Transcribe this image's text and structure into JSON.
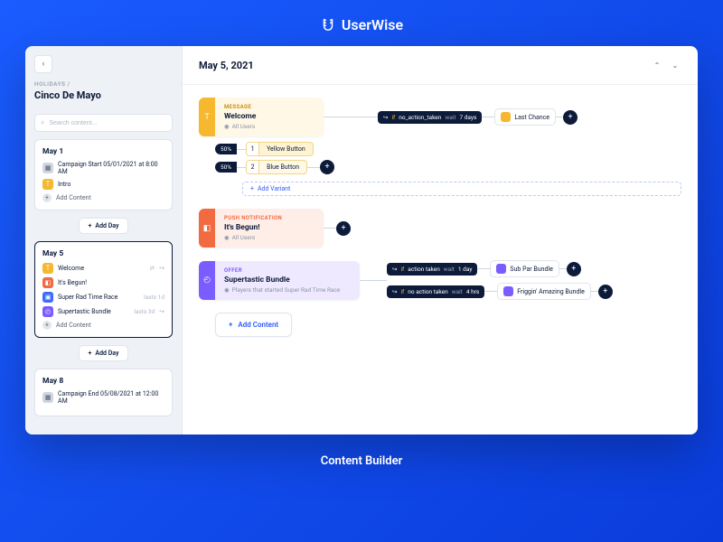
{
  "brand": "UserWise",
  "footer": "Content Builder",
  "sidebar": {
    "breadcrumb": "HOLIDAYS /",
    "title": "Cinco De Mayo",
    "search_placeholder": "Search content...",
    "add_content": "Add Content",
    "add_day": "Add Day",
    "days": [
      {
        "label": "May 1",
        "active": false,
        "items": [
          {
            "badge": "grey",
            "text": "Campaign Start 05/01/2021 at 8:00 AM"
          },
          {
            "badge": "yellow",
            "text": "Intro"
          }
        ]
      },
      {
        "label": "May 5",
        "active": true,
        "items": [
          {
            "badge": "yellow",
            "text": "Welcome",
            "arrow": true
          },
          {
            "badge": "orange",
            "text": "It's Begun!"
          },
          {
            "badge": "blue",
            "text": "Super Rad Time Race",
            "meta": "lasts 1d"
          },
          {
            "badge": "purple",
            "text": "Supertastic Bundle",
            "meta": "lasts 3d",
            "arrow": true
          }
        ]
      },
      {
        "label": "May 8",
        "active": false,
        "items": [
          {
            "badge": "grey",
            "text": "Campaign End 05/08/2021 at 12:00 AM"
          }
        ]
      }
    ]
  },
  "main": {
    "date": "May 5, 2021",
    "add_content": "Add Content",
    "add_variant": "Add Variant"
  },
  "flows": {
    "msg": {
      "type": "MESSAGE",
      "name": "Welcome",
      "audience": "All Users",
      "variants": [
        {
          "pct": "50%",
          "num": "1",
          "label": "Yellow Button"
        },
        {
          "pct": "50%",
          "num": "2",
          "label": "Blue Button"
        }
      ],
      "cond": {
        "if": "no_action_taken",
        "wait": "7 days"
      },
      "next": "Last Chance"
    },
    "push": {
      "type": "PUSH NOTIFICATION",
      "name": "It's Begun!",
      "audience": "All Users"
    },
    "offer": {
      "type": "OFFER",
      "name": "Supertastic Bundle",
      "audience": "Players that started Super Rad Time Race",
      "branches": [
        {
          "if": "action taken",
          "wait": "1 day",
          "next": "Sub Par Bundle"
        },
        {
          "if": "no action taken",
          "wait": "4 hrs",
          "next": "Friggin' Amazing Bundle"
        }
      ]
    }
  }
}
